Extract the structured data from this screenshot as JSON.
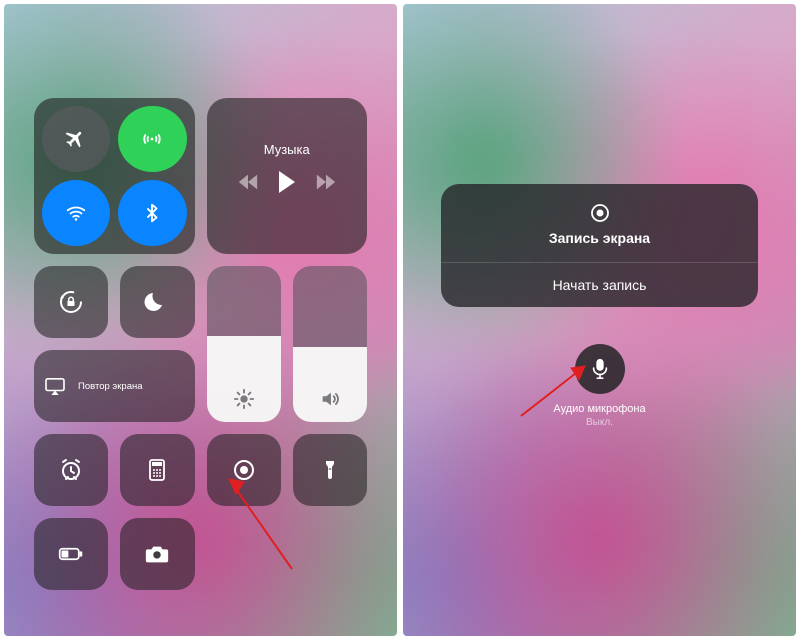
{
  "left": {
    "connectivity": {
      "airplane": "airplane-icon",
      "cellular": "cellular-icon",
      "wifi": "wifi-icon",
      "bluetooth": "bluetooth-icon"
    },
    "media": {
      "title": "Музыка"
    },
    "mirror_label": "Повтор экрана",
    "brightness_pct": 55,
    "volume_pct": 48
  },
  "right": {
    "sheet_title": "Запись экрана",
    "sheet_action": "Начать запись",
    "mic_label": "Аудио микрофона",
    "mic_status": "Выкл."
  }
}
